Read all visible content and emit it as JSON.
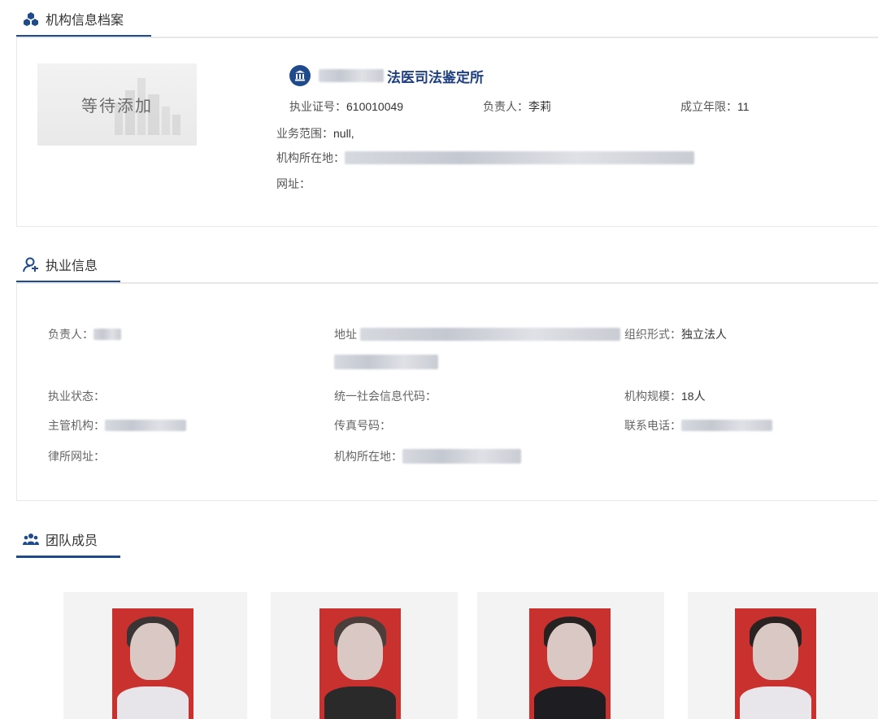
{
  "sections": {
    "archive": {
      "title": "机构信息档案"
    },
    "practice": {
      "title": "执业信息"
    },
    "team": {
      "title": "团队成员"
    }
  },
  "org": {
    "placeholder_text": "等待添加",
    "name_visible": "法医司法鉴定所",
    "license_label": "执业证号：",
    "license_value": "610010049",
    "head_label": "负责人：",
    "head_value": "李莉",
    "years_label": "成立年限：",
    "years_value": "11",
    "scope_label": "业务范围：",
    "scope_value": "null,",
    "location_label": "机构所在地：",
    "website_label": "网址："
  },
  "practice": {
    "head_label": "负责人：",
    "address_label": "地址",
    "org_form_label": "组织形式：",
    "org_form_value": "独立法人",
    "status_label": "执业状态：",
    "credit_code_label": "统一社会信息代码：",
    "scale_label": "机构规模：",
    "scale_value": "18人",
    "authority_label": "主管机构：",
    "fax_label": "传真号码：",
    "phone_label": "联系电话：",
    "firm_site_label": "律所网址：",
    "location_label": "机构所在地："
  },
  "colors": {
    "accent": "#1f4a8c",
    "photo_bg": "#c9312f"
  },
  "icons": {
    "archive": "cubes-icon",
    "practice": "user-badge-icon",
    "team": "team-icon",
    "org": "bank-icon"
  }
}
